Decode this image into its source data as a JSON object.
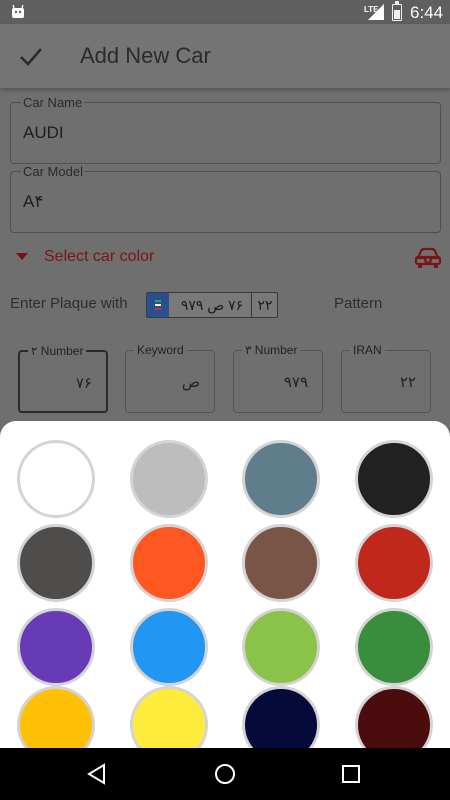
{
  "status_bar": {
    "time": "6:44",
    "network": "LTE"
  },
  "app_bar": {
    "title": "Add New Car"
  },
  "form": {
    "car_name": {
      "label": "Car Name",
      "value": "AUDI"
    },
    "car_model": {
      "label": "Car Model",
      "value": "A۴"
    },
    "select_color": {
      "label": "Select car color"
    },
    "plaque": {
      "enter_label": "Enter Plaque with",
      "pattern_label": "Pattern",
      "plate_main": "۷۶ ص ۹۷۹",
      "plate_iran": "۲۲"
    },
    "plaque_fields": [
      {
        "label": "۲ Number",
        "value": "۷۶"
      },
      {
        "label": "Keyword",
        "value": "ص"
      },
      {
        "label": "۳ Number",
        "value": "۹۷۹"
      },
      {
        "label": "IRAN",
        "value": "۲۲"
      }
    ]
  },
  "color_sheet": {
    "colors": [
      "#ffffff",
      "#bdbdbd",
      "#607d8b",
      "#212121",
      "#4f4d4c",
      "#ff5722",
      "#795548",
      "#c0281b",
      "#673ab7",
      "#2196f3",
      "#8bc34a",
      "#388e3c",
      "#ffc107",
      "#ffeb3b",
      "#050a3a",
      "#4a0c0c"
    ]
  },
  "colors": {
    "accent": "#7c1414",
    "overlay": "#6f6f6f"
  }
}
